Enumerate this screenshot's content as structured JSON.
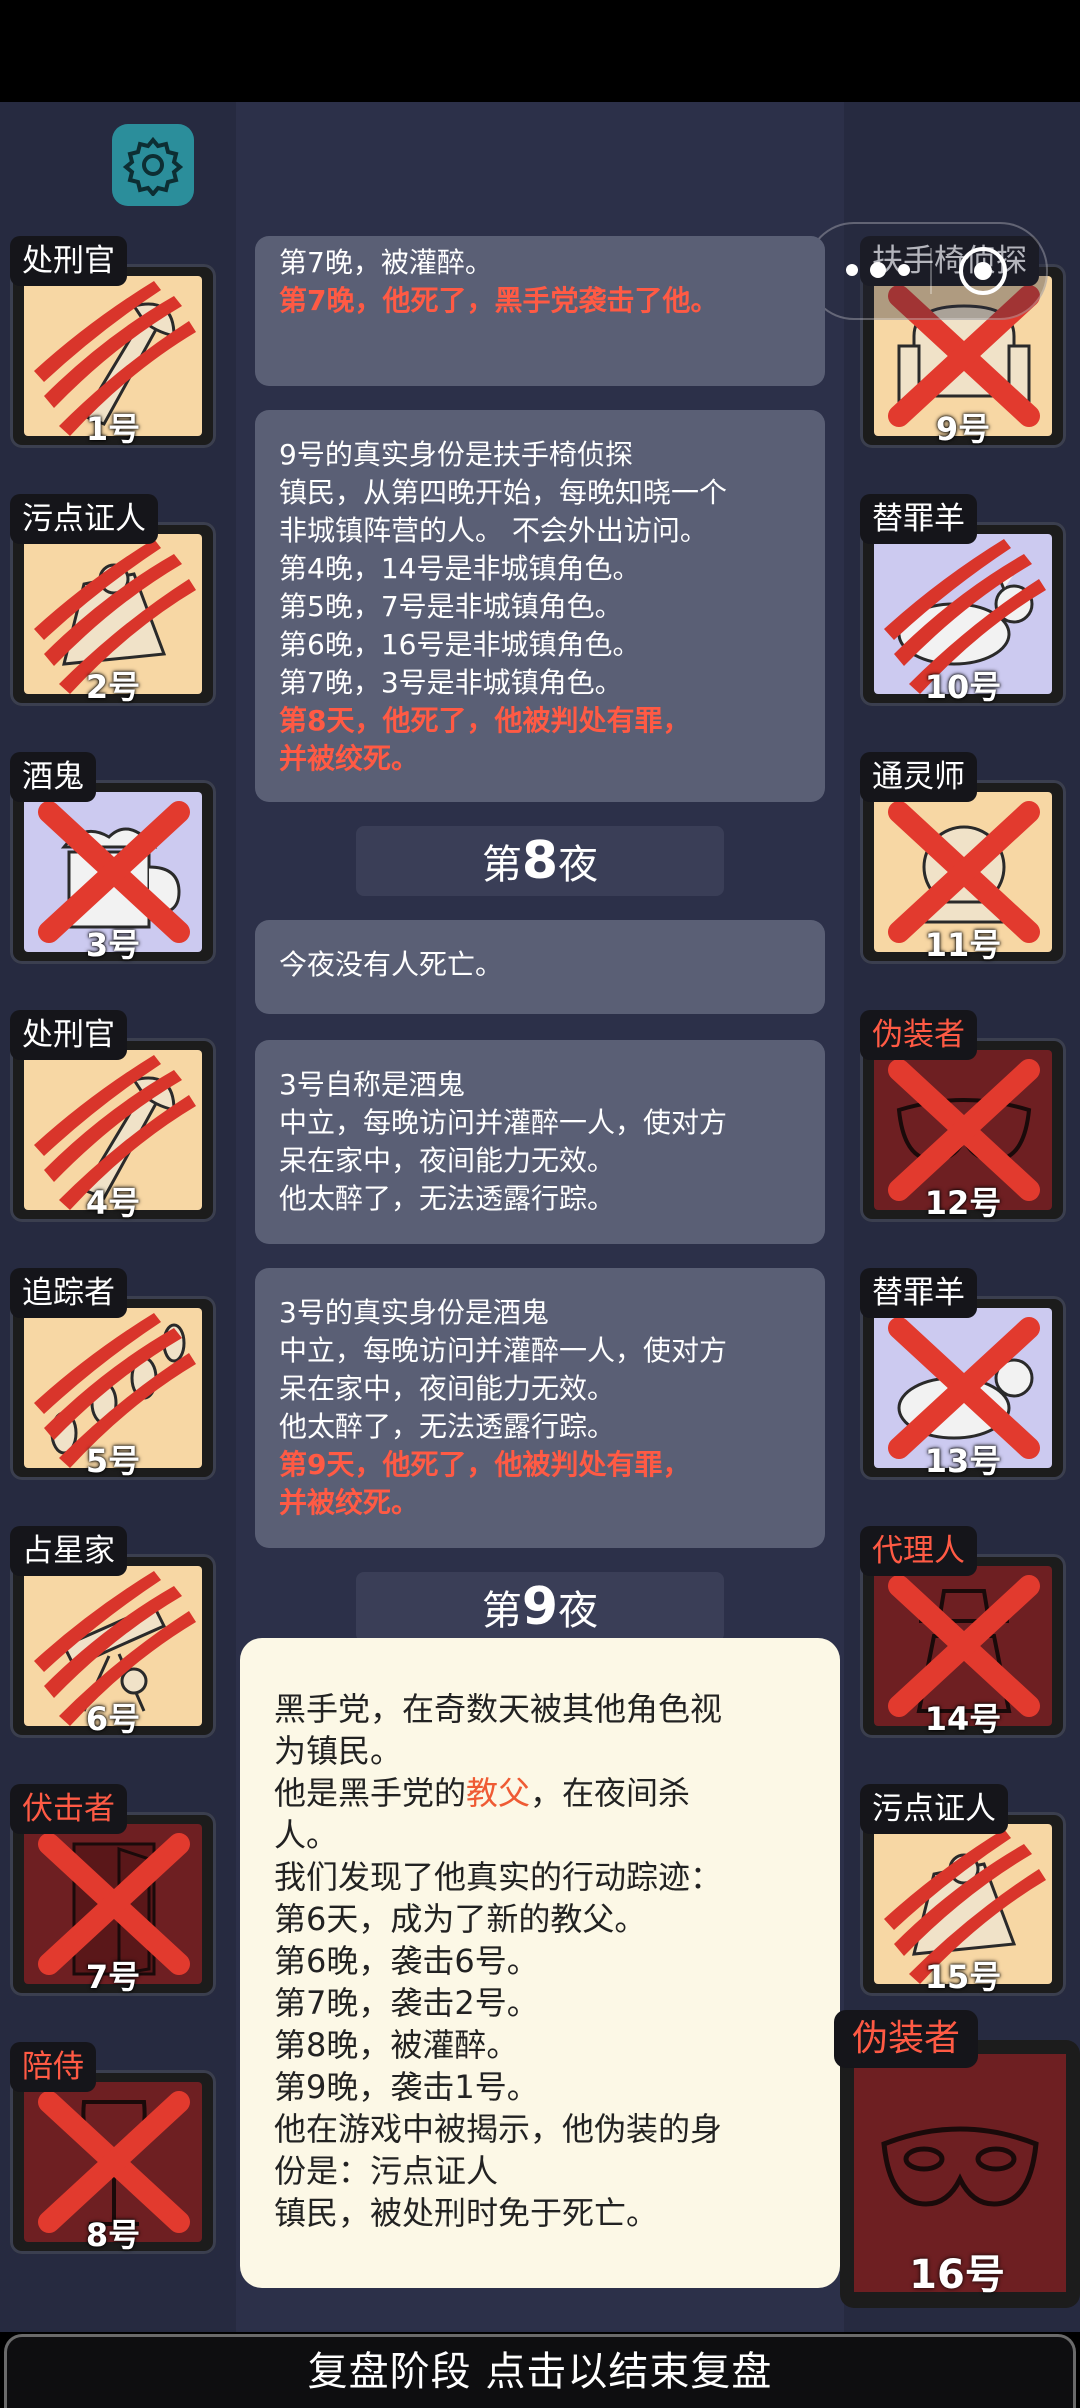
{
  "settings_icon": "gear-icon",
  "capsule": {
    "menu_icon": "more-dots-icon",
    "close_icon": "record-icon"
  },
  "left_players": [
    {
      "role": "处刑官",
      "number": "1号",
      "faction": "town",
      "mark": "claw",
      "icon": "executioner-axe-icon"
    },
    {
      "role": "污点证人",
      "number": "2号",
      "faction": "town",
      "mark": "claw",
      "icon": "tainted-witness-icon"
    },
    {
      "role": "酒鬼",
      "number": "3号",
      "faction": "neutral",
      "mark": "cross",
      "icon": "drunk-mug-icon"
    },
    {
      "role": "处刑官",
      "number": "4号",
      "faction": "town",
      "mark": "claw",
      "icon": "executioner-axe-icon"
    },
    {
      "role": "追踪者",
      "number": "5号",
      "faction": "town",
      "mark": "claw",
      "icon": "tracker-footprints-icon"
    },
    {
      "role": "占星家",
      "number": "6号",
      "faction": "town",
      "mark": "claw",
      "icon": "astrologer-telescope-icon"
    },
    {
      "role": "伏击者",
      "number": "7号",
      "faction": "mafia",
      "mark": "cross",
      "icon": "ambusher-door-icon"
    },
    {
      "role": "陪侍",
      "number": "8号",
      "faction": "mafia",
      "mark": "cross",
      "icon": "escort-wineglass-icon"
    }
  ],
  "right_players": [
    {
      "role": "扶手椅侦探",
      "number": "9号",
      "faction": "town",
      "mark": "cross",
      "icon": "armchair-icon"
    },
    {
      "role": "替罪羊",
      "number": "10号",
      "faction": "neutral",
      "mark": "claw",
      "icon": "scapegoat-icon"
    },
    {
      "role": "通灵师",
      "number": "11号",
      "faction": "town",
      "mark": "cross",
      "icon": "medium-orb-icon"
    },
    {
      "role": "伪装者",
      "number": "12号",
      "faction": "mafia",
      "mark": "cross",
      "icon": "disguiser-mask-icon"
    },
    {
      "role": "替罪羊",
      "number": "13号",
      "faction": "neutral",
      "mark": "cross",
      "icon": "scapegoat-icon"
    },
    {
      "role": "代理人",
      "number": "14号",
      "faction": "mafia",
      "mark": "cross",
      "icon": "agent-hat-icon"
    },
    {
      "role": "污点证人",
      "number": "15号",
      "faction": "town",
      "mark": "claw",
      "icon": "tainted-witness-icon"
    }
  ],
  "highlight_player": {
    "role": "伪装者",
    "number": "16号",
    "icon": "disguiser-mask-icon"
  },
  "log": {
    "bubble1": {
      "line1": "第7晚，被灌醉。",
      "red": "第7晚，他死了，黑手党袭击了他。"
    },
    "bubble2": {
      "lines": [
        "9号的真实身份是扶手椅侦探",
        "镇民，从第四晚开始，每晚知晓一个",
        "非城镇阵营的人。 不会外出访问。",
        "第4晚，14号是非城镇角色。",
        "第5晚，7号是非城镇角色。",
        "第6晚，16号是非城镇角色。",
        "第7晚，3号是非城镇角色。"
      ],
      "red1": "第8天，他死了，他被判处有罪，",
      "red2": "并被绞死。"
    },
    "night8": {
      "prefix": "第",
      "number": "8",
      "suffix": "夜"
    },
    "bubble3": {
      "text": "今夜没有人死亡。"
    },
    "bubble4": {
      "lines": [
        "3号自称是酒鬼",
        "中立，每晚访问并灌醉一人，使对方",
        "呆在家中，夜间能力无效。",
        "他太醉了，无法透露行踪。"
      ]
    },
    "bubble5": {
      "lines": [
        "3号的真实身份是酒鬼",
        "中立，每晚访问并灌醉一人，使对方",
        "呆在家中，夜间能力无效。",
        "他太醉了，无法透露行踪。"
      ],
      "red1": "第9天，他死了，他被判处有罪，",
      "red2": "并被绞死。"
    },
    "night9": {
      "prefix": "第",
      "number": "9",
      "suffix": "夜"
    }
  },
  "popup": {
    "line1": "黑手党，在奇数天被其他角色视",
    "line2": "为镇民。",
    "line3_pre": "他是黑手党的",
    "line3_red": "教父",
    "line3_post": "，在夜间杀",
    "line4": "人。",
    "lines": [
      "我们发现了他真实的行动踪迹：",
      "第6天，成为了新的教父。",
      "第6晚，袭击6号。",
      "第7晚，袭击2号。",
      "第8晚，被灌醉。",
      "第9晚，袭击1号。",
      "他在游戏中被揭示，他伪装的身",
      "份是：污点证人",
      "镇民，被处刑时免于死亡。"
    ]
  },
  "bottom_button": "复盘阶段 点击以结束复盘",
  "colors": {
    "town": "#f7d7a4",
    "neutral": "#cccaf0",
    "mafia": "#6e1f22",
    "death_text": "#ff5a44",
    "claw": "#d9352b"
  }
}
